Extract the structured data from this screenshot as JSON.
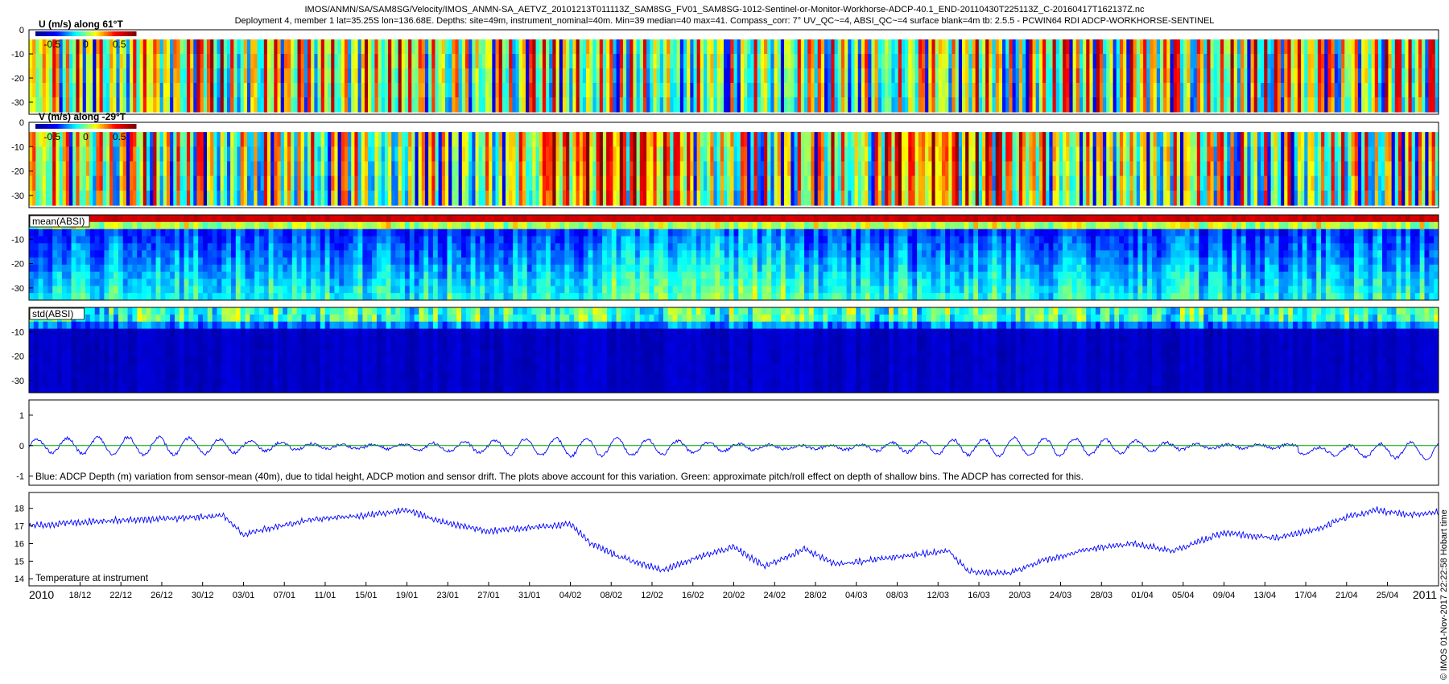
{
  "header": {
    "line1": "IMOS/ANMN/SA/SAM8SG/Velocity/IMOS_ANMN-SA_AETVZ_20101213T011113Z_SAM8SG_FV01_SAM8SG-1012-Sentinel-or-Monitor-Workhorse-ADCP-40.1_END-20110430T225113Z_C-20160417T162137Z.nc",
    "line2": "Deployment 4, member 1 lat=35.25S lon=136.68E. Depths: site=49m, instrument_nominal=40m. Min=39 median=40 max=41. Compass_corr: 7° UV_QC~=4, ABSI_QC~=4 surface blank=4m tb: 2.5.5 - PCWIN64 RDI ADCP-WORKHORSE-SENTINEL"
  },
  "credit": "© IMOS 01-Nov-2017 22:22:58 Hobart time",
  "colors": {
    "jet": [
      "#00008f",
      "#0000ff",
      "#00ffff",
      "#ffff00",
      "#ff0000",
      "#800000"
    ],
    "line_blue": "#0000ff",
    "line_green": "#00aa00"
  },
  "chart_data": [
    {
      "type": "heatmap",
      "title": "U (m/s) along 61°T",
      "colorbar_ticks": [
        "-0.5",
        "0",
        "0.5"
      ],
      "clim": [
        -0.75,
        0.75
      ],
      "yticks": [
        0,
        -10,
        -20,
        -30
      ],
      "ylim": [
        -35,
        0
      ],
      "valid_depth_range": [
        -34,
        -4
      ]
    },
    {
      "type": "heatmap",
      "title": "V (m/s) along -29°T",
      "colorbar_ticks": [
        "-0.5",
        "0",
        "0.5"
      ],
      "clim": [
        -0.75,
        0.75
      ],
      "yticks": [
        0,
        -10,
        -20,
        -30
      ],
      "ylim": [
        -35,
        0
      ],
      "valid_depth_range": [
        -34,
        -4
      ]
    },
    {
      "type": "heatmap",
      "title": "mean(ABSI)",
      "yticks": [
        -10,
        -20,
        -30
      ],
      "ylim": [
        -35,
        0
      ]
    },
    {
      "type": "heatmap",
      "title": "std(ABSI)",
      "yticks": [
        -10,
        -20,
        -30
      ],
      "ylim": [
        -35,
        0
      ]
    },
    {
      "type": "line",
      "annotation": "Blue: ADCP Depth (m) variation from sensor-mean (40m), due to tidal height, ADCP motion and sensor drift. The plots above account for this variation. Green: approximate pitch/roll effect on depth of shallow bins. The ADCP has corrected for this.",
      "yticks": [
        1,
        0,
        -1
      ],
      "ylim": [
        -1.3,
        1.5
      ],
      "series": [
        {
          "color": "blue",
          "x": [
            "2010-12-13",
            "2011-04-30"
          ],
          "amplitude": 0.3,
          "range": [
            -0.8,
            0.6
          ]
        },
        {
          "color": "green",
          "x": [
            "2010-12-13",
            "2011-04-30"
          ],
          "values": [
            0,
            0
          ]
        }
      ]
    },
    {
      "type": "line",
      "annotation": "Temperature at instrument",
      "yticks": [
        18,
        17,
        16,
        15,
        14
      ],
      "ylim": [
        13.6,
        18.9
      ],
      "series": [
        {
          "color": "blue",
          "x": [
            "2010-12-13",
            "2010-12-20",
            "2010-12-27",
            "2011-01-01",
            "2011-01-03",
            "2011-01-05",
            "2011-01-10",
            "2011-01-15",
            "2011-01-19",
            "2011-01-22",
            "2011-01-27",
            "2011-01-31",
            "2011-02-04",
            "2011-02-06",
            "2011-02-09",
            "2011-02-13",
            "2011-02-17",
            "2011-02-20",
            "2011-02-23",
            "2011-02-27",
            "2011-03-02",
            "2011-03-06",
            "2011-03-10",
            "2011-03-13",
            "2011-03-15",
            "2011-03-19",
            "2011-03-22",
            "2011-03-27",
            "2011-03-31",
            "2011-04-04",
            "2011-04-09",
            "2011-04-14",
            "2011-04-18",
            "2011-04-21",
            "2011-04-24",
            "2011-04-27",
            "2011-04-30"
          ],
          "values": [
            17.0,
            17.3,
            17.4,
            17.6,
            16.5,
            16.8,
            17.4,
            17.6,
            17.9,
            17.3,
            16.7,
            16.9,
            17.1,
            16.0,
            15.2,
            14.5,
            15.3,
            15.8,
            14.7,
            15.7,
            14.8,
            15.1,
            15.4,
            15.6,
            14.4,
            14.3,
            15.0,
            15.7,
            16.0,
            15.6,
            16.6,
            16.3,
            16.8,
            17.5,
            17.9,
            17.6,
            17.8
          ]
        }
      ]
    }
  ],
  "time_axis": {
    "start": "2010-12-13",
    "end": "2011-04-30",
    "tick_labels": [
      "18/12",
      "22/12",
      "26/12",
      "30/12",
      "03/01",
      "07/01",
      "11/01",
      "15/01",
      "19/01",
      "23/01",
      "27/01",
      "31/01",
      "04/02",
      "08/02",
      "12/02",
      "16/02",
      "20/02",
      "24/02",
      "28/02",
      "04/03",
      "08/03",
      "12/03",
      "16/03",
      "20/03",
      "24/03",
      "28/03",
      "01/04",
      "05/04",
      "09/04",
      "13/04",
      "17/04",
      "21/04",
      "25/04"
    ],
    "year_start": "2010",
    "year_end": "2011"
  }
}
